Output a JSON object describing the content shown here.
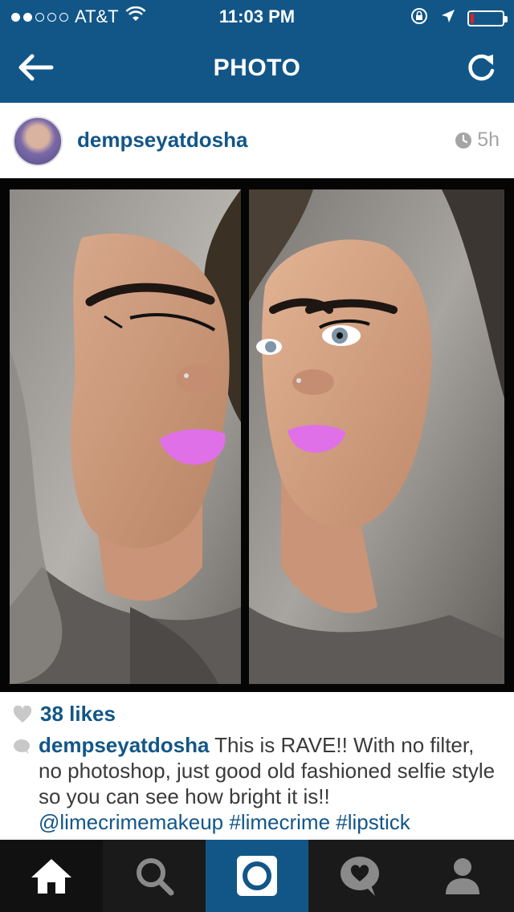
{
  "status_bar": {
    "carrier": "AT&T",
    "time": "11:03 PM",
    "signal_dots_filled": 2,
    "signal_dots_total": 5,
    "battery_level": 0.1
  },
  "nav": {
    "title": "PHOTO",
    "back_icon": "arrow-left-icon",
    "refresh_icon": "refresh-icon"
  },
  "post": {
    "username": "dempseyatdosha",
    "time_ago": "5h",
    "likes": "38 likes",
    "caption_user": "dempseyatdosha",
    "caption_text": "This is RAVE!! With no filter, no photoshop, just good old fashioned selfie style so you can see how bright it is!!",
    "tags": [
      "@limecrimemakeup",
      "#limecrime",
      "#lipstick"
    ]
  },
  "tabs": [
    {
      "name": "home",
      "icon": "home-icon"
    },
    {
      "name": "search",
      "icon": "search-icon"
    },
    {
      "name": "camera",
      "icon": "camera-icon"
    },
    {
      "name": "activity",
      "icon": "heart-bubble-icon"
    },
    {
      "name": "profile",
      "icon": "person-icon"
    }
  ],
  "colors": {
    "brand": "#125688",
    "lip": "#e070e8",
    "battery_low": "#e02020"
  }
}
